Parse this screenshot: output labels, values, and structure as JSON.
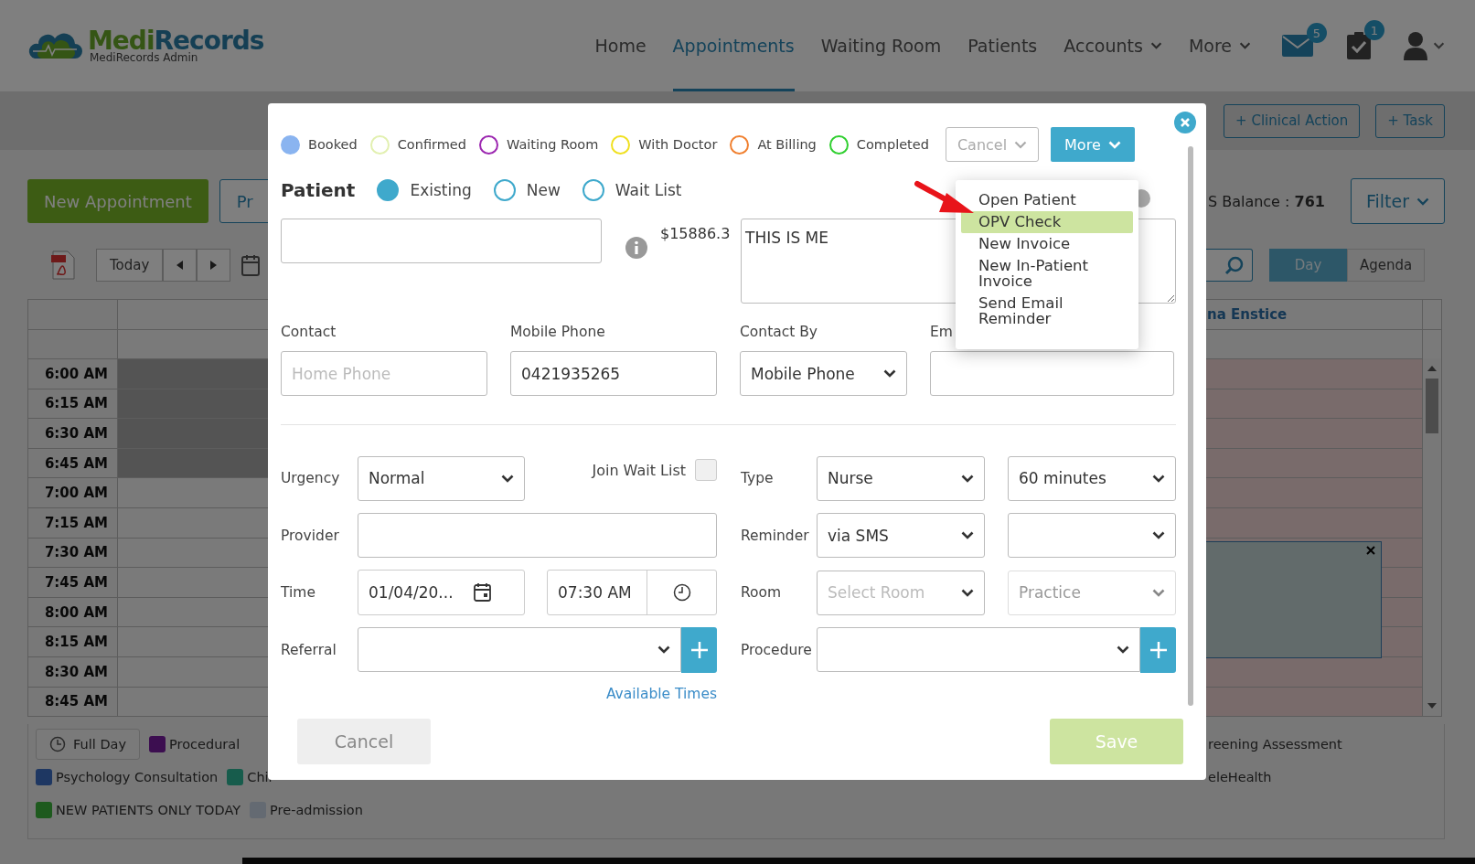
{
  "header": {
    "logo_part_1": "Medi",
    "logo_part_2": "Records",
    "logo_sub": "MediRecords Admin",
    "nav": [
      {
        "label": "Home",
        "selected": false,
        "dropdown": false
      },
      {
        "label": "Appointments",
        "selected": true,
        "dropdown": false
      },
      {
        "label": "Waiting Room",
        "selected": false,
        "dropdown": false
      },
      {
        "label": "Patients",
        "selected": false,
        "dropdown": false
      },
      {
        "label": "Accounts",
        "selected": false,
        "dropdown": true
      },
      {
        "label": "More",
        "selected": false,
        "dropdown": true
      }
    ],
    "mail_badge": "5",
    "tasks_badge": "1"
  },
  "toolbar": {
    "buttons": [
      "+ Clinical Action",
      "+ Task"
    ]
  },
  "calendar": {
    "new_appointment": "New Appointment",
    "print_button": "Pr",
    "balance": "S Balance : **761**",
    "filter": "Filter",
    "today": "Today",
    "views": [
      {
        "label": "Day",
        "selected": true
      },
      {
        "label": "Agenda",
        "selected": false
      }
    ],
    "provider_heading": "na Enstice",
    "times": [
      {
        "label": "6:00 AM",
        "available": false
      },
      {
        "label": "6:15 AM",
        "available": false
      },
      {
        "label": "6:30 AM",
        "available": false
      },
      {
        "label": "6:45 AM",
        "available": false
      },
      {
        "label": "7:00 AM",
        "available": true
      },
      {
        "label": "7:15 AM",
        "available": true
      },
      {
        "label": "7:30 AM",
        "available": true
      },
      {
        "label": "7:45 AM",
        "available": true
      },
      {
        "label": "8:00 AM",
        "available": true
      },
      {
        "label": "8:15 AM",
        "available": true
      },
      {
        "label": "8:30 AM",
        "available": true
      },
      {
        "label": "8:45 AM",
        "available": true
      }
    ]
  },
  "legend": [
    [
      {
        "kind": "button",
        "label": "Full Day"
      },
      {
        "kind": "entry",
        "label": "Procedural",
        "color": "#3c0e50"
      },
      {
        "kind": "cut",
        "label": "reening Assessment"
      }
    ],
    [
      {
        "kind": "entry",
        "label": "Psychology Consultation",
        "color": "#1e3762"
      },
      {
        "kind": "entry",
        "label": "Chil",
        "color": "#175c4c"
      },
      {
        "kind": "cut",
        "label": "eleHealth"
      }
    ],
    [
      {
        "kind": "entry",
        "label": "NEW PATIENTS ONLY TODAY",
        "color": "#1e5a1e"
      },
      {
        "kind": "entry",
        "label": "Pre-admission",
        "color": "#646a72"
      }
    ]
  ],
  "modal": {
    "statuses": [
      {
        "label": "Booked",
        "color": "#8ab4f0",
        "selected": true
      },
      {
        "label": "Confirmed",
        "color": "#e2f0b0",
        "selected": false
      },
      {
        "label": "Waiting Room",
        "color": "#9c27b0",
        "selected": false
      },
      {
        "label": "With Doctor",
        "color": "#f0e020",
        "selected": false
      },
      {
        "label": "At Billing",
        "color": "#f08030",
        "selected": false
      },
      {
        "label": "Completed",
        "color": "#2fcf2f",
        "selected": false
      }
    ],
    "status_select": "Cancel",
    "more_button": "More",
    "patient_label": "Patient",
    "patient_options": [
      {
        "label": "Existing",
        "selected": true
      },
      {
        "label": "New",
        "selected": false
      },
      {
        "label": "Wait List",
        "selected": false
      }
    ],
    "balance": "$15886.3",
    "notes": "THIS IS ME",
    "contact": {
      "label": "Contact",
      "placeholder": "Home Phone"
    },
    "mobile": {
      "label": "Mobile Phone",
      "value": "0421935265"
    },
    "contact_by": {
      "label": "Contact By",
      "value": "Mobile Phone"
    },
    "email": {
      "label": "Em"
    },
    "urgency": {
      "label": "Urgency",
      "value": "Normal"
    },
    "join_wait_list": {
      "label": "Join Wait List",
      "checked": false
    },
    "type": {
      "label": "Type",
      "value": "Nurse",
      "duration": "60 minutes"
    },
    "provider": {
      "label": "Provider"
    },
    "reminder": {
      "label": "Reminder",
      "value": "via SMS"
    },
    "time": {
      "label": "Time",
      "date": "01/04/20...",
      "time": "07:30 AM"
    },
    "room": {
      "label": "Room",
      "placeholder": "Select Room",
      "practice_placeholder": "Practice"
    },
    "referral": {
      "label": "Referral"
    },
    "procedure": {
      "label": "Procedure"
    },
    "available_times": "Available Times",
    "cancel_button": "Cancel",
    "save_button": {
      "label": "Save",
      "disabled": true
    }
  },
  "more_menu": {
    "items": [
      {
        "label": "Open Patient",
        "selected": false
      },
      {
        "label": "OPV Check",
        "selected": true
      },
      {
        "label": "New Invoice",
        "selected": false
      },
      {
        "label": "New In-Patient Invoice",
        "selected": false
      },
      {
        "label": "Send Email Reminder",
        "selected": false
      }
    ]
  }
}
